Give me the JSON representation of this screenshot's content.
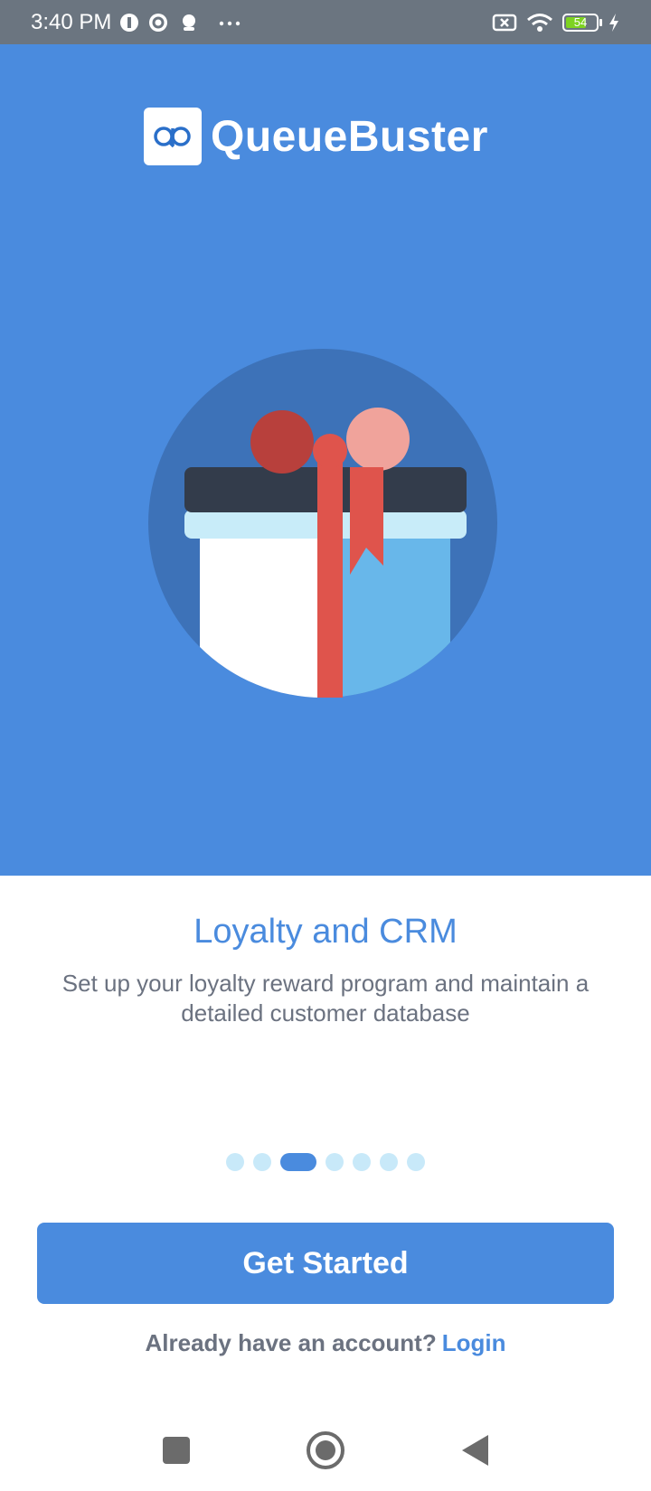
{
  "status_bar": {
    "time": "3:40 PM",
    "battery": "54",
    "icons": [
      "app-icon",
      "sync-icon",
      "notification-icon",
      "more-icon",
      "no-sim-icon",
      "wifi-icon",
      "battery-icon",
      "charging-icon"
    ]
  },
  "logo": {
    "text": "QueueBuster",
    "mark": "QB"
  },
  "slide": {
    "title": "Loyalty and CRM",
    "description": "Set up your loyalty reward program and maintain a detailed customer database"
  },
  "pagination": {
    "count": 7,
    "active_index": 2
  },
  "cta": {
    "label": "Get Started"
  },
  "account": {
    "prompt": "Already have an account?",
    "login_label": "Login"
  },
  "colors": {
    "brand": "#4a8bde",
    "status_bar": "#6b7580",
    "dot_inactive": "#c8e9f9",
    "text_muted": "#6b7280"
  }
}
